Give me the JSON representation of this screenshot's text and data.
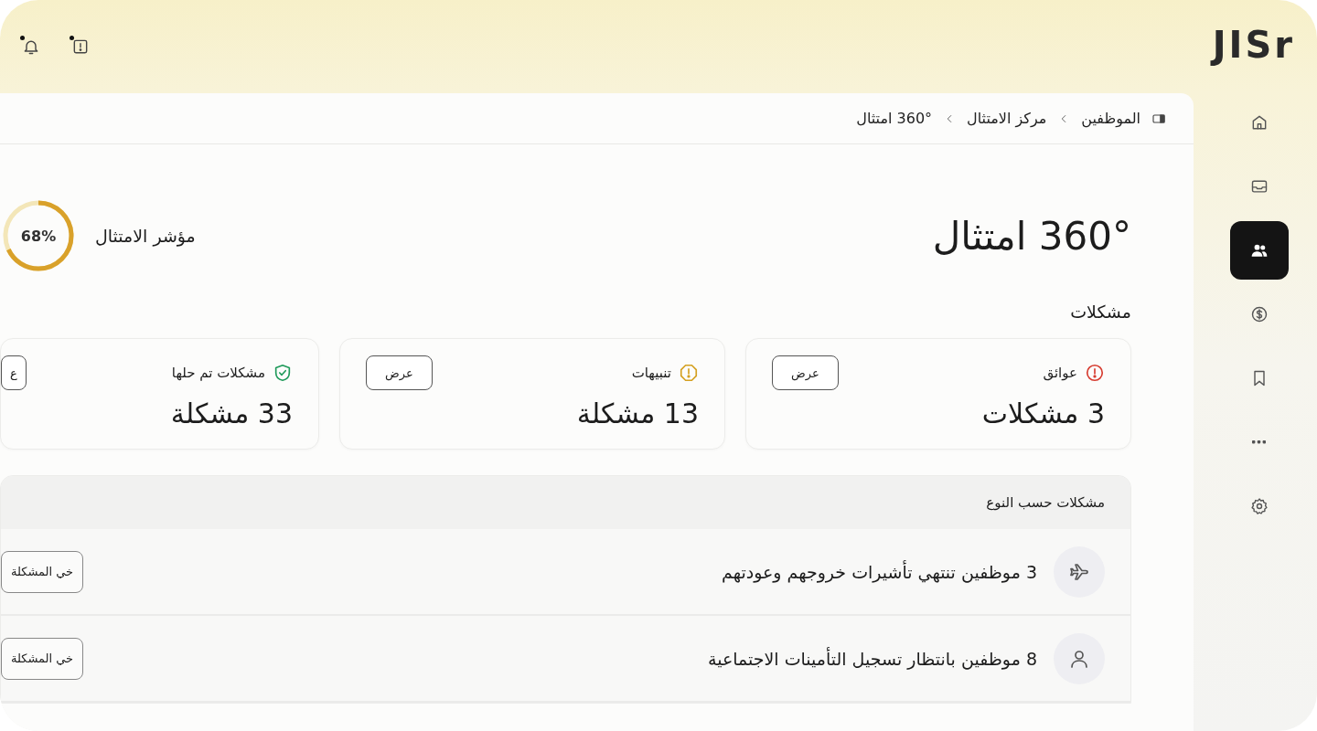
{
  "logo": "JISr",
  "top_actions": [
    {
      "kind": "alert",
      "badge": true
    },
    {
      "kind": "bell",
      "badge": true
    }
  ],
  "sidebar": {
    "items": [
      {
        "kind": "home",
        "selected": false
      },
      {
        "kind": "inbox",
        "selected": false
      },
      {
        "kind": "users",
        "selected": true
      },
      {
        "kind": "dollar",
        "selected": false
      },
      {
        "kind": "bookmark",
        "selected": false
      },
      {
        "kind": "more",
        "selected": false
      },
      {
        "kind": "settings",
        "selected": false
      }
    ]
  },
  "breadcrumb": [
    "الموظفين",
    "مركز الامتثال",
    "360° امتثال"
  ],
  "title": "360° امتثال",
  "compliance": {
    "label": "مؤشر الامتثال",
    "value": "68%",
    "level": 0.68
  },
  "section_title": "مشكلات",
  "cards": [
    {
      "kind": "blocker",
      "label": "عوائق",
      "count": "3 مشكلات",
      "button": "عرض"
    },
    {
      "kind": "warning",
      "label": "تنبيهات",
      "count": "13 مشكلة",
      "button": "عرض"
    },
    {
      "kind": "resolved",
      "label": "مشكلات تم حلها",
      "count": "33 مشكلة",
      "button": "ع"
    }
  ],
  "issues_by_type": {
    "title": "مشكلات حسب النوع",
    "rows": [
      {
        "kind": "plane",
        "text": "3 موظفين تنتهي تأشيرات خروجهم وعودتهم",
        "button": "خي المشكلة"
      },
      {
        "kind": "person",
        "text": "8  موظفين بانتظار تسجيل التأمينات الاجتماعية",
        "button": "خي المشكلة"
      }
    ]
  }
}
